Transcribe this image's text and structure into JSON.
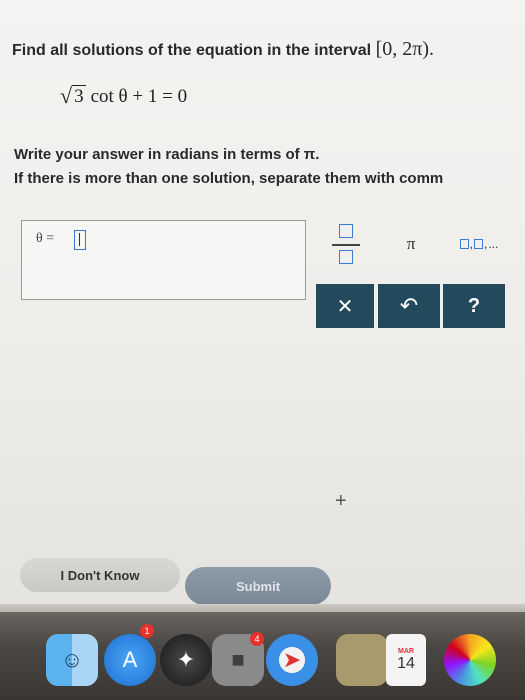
{
  "question": {
    "prompt": "Find all solutions of the equation in the interval",
    "interval": "[0, 2π)."
  },
  "equation": {
    "sqrt_sign": "√",
    "radicand": "3",
    "rest": "cot θ + 1 = 0"
  },
  "instructions": {
    "line1": "Write your answer in radians in terms of π.",
    "line2": "If there is more than one solution, separate them with comm"
  },
  "answer": {
    "label": "θ ="
  },
  "keypad": {
    "pi": "π",
    "list_separator": ",",
    "list_ellipsis": "...",
    "clear": "✕",
    "undo": "↶",
    "help": "?"
  },
  "cursor": "+",
  "buttons": {
    "dont_know": "I Don't Know",
    "submit": "Submit"
  },
  "dock": {
    "appstore_badge": "1",
    "facetime_badge": "4",
    "calendar_month": "MAR",
    "calendar_day": "14"
  },
  "colors": {
    "keypad_dark": "#23495c",
    "input_outline": "#3b7bd8",
    "submit": "#7b8896"
  }
}
